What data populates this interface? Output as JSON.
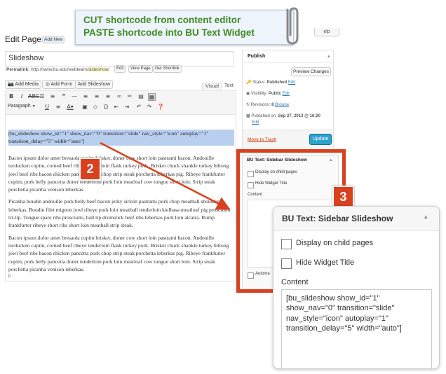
{
  "callout": {
    "line1": "CUT shortcode from content editor",
    "line2": "PASTE shortcode into BU Text Widget",
    "step2": "2",
    "step3": "3"
  },
  "header": {
    "title": "Edit Page",
    "add_new": "Add New",
    "help": "elp"
  },
  "post": {
    "title_value": "Slideshow",
    "permalink_label": "Permalink:",
    "permalink_prefix": "http://www.bu.edu/webteam/",
    "permalink_slug": "slideshow",
    "permalink_suffix": "/",
    "edit_btn": "Edit",
    "view_page_btn": "View Page",
    "shortlink_btn": "Get Shortlink"
  },
  "media_buttons": {
    "add_media": "Add Media",
    "add_form": "Add Form",
    "add_slideshow": "Add Slideshow"
  },
  "editor_tabs": {
    "visual": "Visual",
    "text": "Text"
  },
  "format_select": "Paragraph",
  "editor": {
    "shortcode": "[bu_slideshow show_id=\"1\" show_nav=\"0\" transition=\"slide\" nav_style=\"icon\" autoplay=\"1\" transition_delay=\"5\" width=\"auto\"]",
    "para1": "Bacon ipsum dolor amet bresaola cupim brisket, doner cow short loin pastrami bacon. Andouille turducken cupim, corned beef ribeye tenderloin flank turkey pork. Brisket chuck shankle turkey biltong jowl beef ribs bacon chicken pancetta pork chop strip steak porchetta leberkas pig. Ribeye frankfurter cupim, pork belly pancetta doner tenderloin pork loin meatloaf cow tongue short loin. Strip steak porchetta picanha venison leberkas.",
    "para2": "Picanha boudin andouille pork belly beef bacon jerky sirloin pastrami pork chop meatball shoulder leberkas. Boudin filet mignon jowl ribeye pork loin meatball tenderloin kielbasa meatloaf pig prosciutto tri-tip. Tongue spare ribs prosciutto, ball tip drumstick beef ribs leberkas pork loin alcatra. Rump frankfurter ribeye short ribs short loin meatball strip steak.",
    "para3": "Bacon ipsum dolor amet bresaola cupim brisket, doner cow short loin pastrami bacon. Andouille turducken cupim, corned beef ribeye tenderloin flank turkey pork. Brisket chuck shankle turkey biltong jowl beef ribs bacon chicken pancetta pork chop strip steak porchetta leberkas pig. Ribeye frankfurter cupim, pork belly pancetta doner tenderloin pork loin meatloaf cow tongue short loin. Strip steak porchetta picanha venison leberkas.",
    "path": "p"
  },
  "publish": {
    "title": "Publish",
    "preview_btn": "Preview Changes",
    "status_label": "Status:",
    "status_value": "Published",
    "status_edit": "Edit",
    "visibility_label": "Visibility:",
    "visibility_value": "Public",
    "visibility_edit": "Edit",
    "revisions_label": "Revisions:",
    "revisions_value": "8",
    "revisions_browse": "Browse",
    "published_label": "Published on:",
    "published_value": "Sep 27, 2013 @ 16:20",
    "published_edit": "Edit",
    "trash": "Move to Trash",
    "update_btn": "Update"
  },
  "widget_small": {
    "title": "BU Text: Sidebar Slideshow",
    "display_child": "Display on child pages",
    "hide_title": "Hide Widget Title",
    "content_label": "Content",
    "automa": "Automa"
  },
  "widget_zoom": {
    "title": "BU Text: Sidebar Slideshow",
    "display_child": "Display on child pages",
    "hide_title": "Hide Widget Title",
    "content_label": "Content",
    "content_value": "[bu_slideshow show_id=\"1\" show_nav=\"0\" transition=\"slide\" nav_style=\"icon\" autoplay=\"1\" transition_delay=\"5\" width=\"auto\"]"
  },
  "colors": {
    "callout_bg": "#eef4fb",
    "callout_text": "#3f8a24",
    "highlight_bg": "#b9cff0",
    "step_badge": "#d9411e",
    "link": "#2a7fb4",
    "update_btn": "#2ea2cc",
    "trash": "#cc3300"
  }
}
